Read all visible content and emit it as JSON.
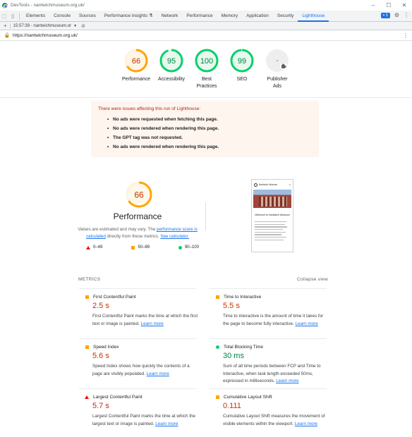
{
  "window": {
    "title": "DevTools - nantwichmuseum.org.uk/"
  },
  "devtools": {
    "tabs": [
      "Elements",
      "Console",
      "Sources",
      "Performance insights",
      "Network",
      "Performance",
      "Memory",
      "Application",
      "Security",
      "Lighthouse"
    ],
    "active_tab": "Lighthouse",
    "issues_badge": "1",
    "report_time": "15:57:39 - nantwichmuseum.or",
    "url": "https://nantwichmuseum.org.uk/"
  },
  "scores": [
    {
      "label": "Performance",
      "value": "66",
      "score": 66,
      "color": "#ffa400",
      "text_color": "#c33300"
    },
    {
      "label": "Accessibility",
      "value": "95",
      "score": 95,
      "color": "#0cce6b",
      "text_color": "#018642"
    },
    {
      "label": "Best Practices",
      "value": "100",
      "score": 100,
      "color": "#0cce6b",
      "text_color": "#018642"
    },
    {
      "label": "SEO",
      "value": "99",
      "score": 99,
      "color": "#0cce6b",
      "text_color": "#018642"
    },
    {
      "label": "Publisher Ads",
      "value": "-",
      "score": null,
      "color": "#bdbdbd",
      "text_color": "#5f6368"
    }
  ],
  "warning": {
    "title": "There were issues affecting this run of Lighthouse:",
    "items": [
      "No ads were requested when fetching this page.",
      "No ads were rendered when rendering this page.",
      "The GPT tag was not requested.",
      "No ads were rendered when rendering this page."
    ]
  },
  "performance": {
    "score": "66",
    "title": "Performance",
    "desc_pre": "Values are estimated and may vary. The ",
    "desc_link1": "performance score is calculated",
    "desc_mid": " directly from these metrics. ",
    "desc_link2": "See calculator.",
    "legend": [
      "0–49",
      "50–89",
      "90–100"
    ]
  },
  "thumbnail": {
    "site_name": "Nantwich Museum",
    "welcome": "Welcome to Nantwich Museum"
  },
  "metrics": {
    "header": "METRICS",
    "collapse": "Collapse view",
    "learn_more": "Learn more",
    "items": [
      {
        "name": "First Contentful Paint",
        "value": "2.5 s",
        "rating": "average",
        "desc": "First Contentful Paint marks the time at which the first text or image is painted. "
      },
      {
        "name": "Time to Interactive",
        "value": "5.5 s",
        "rating": "average",
        "desc": "Time to interactive is the amount of time it takes for the page to become fully interactive. "
      },
      {
        "name": "Speed Index",
        "value": "5.6 s",
        "rating": "average",
        "desc": "Speed Index shows how quickly the contents of a page are visibly populated. "
      },
      {
        "name": "Total Blocking Time",
        "value": "30 ms",
        "rating": "pass",
        "desc": "Sum of all time periods between FCP and Time to Interactive, when task length exceeded 50ms, expressed in milliseconds. "
      },
      {
        "name": "Largest Contentful Paint",
        "value": "5.7 s",
        "rating": "fail",
        "desc": "Largest Contentful Paint marks the time at which the largest text or image is painted. "
      },
      {
        "name": "Cumulative Layout Shift",
        "value": "0.111",
        "rating": "average",
        "desc": "Cumulative Layout Shift measures the movement of visible elements within the viewport. "
      }
    ]
  }
}
